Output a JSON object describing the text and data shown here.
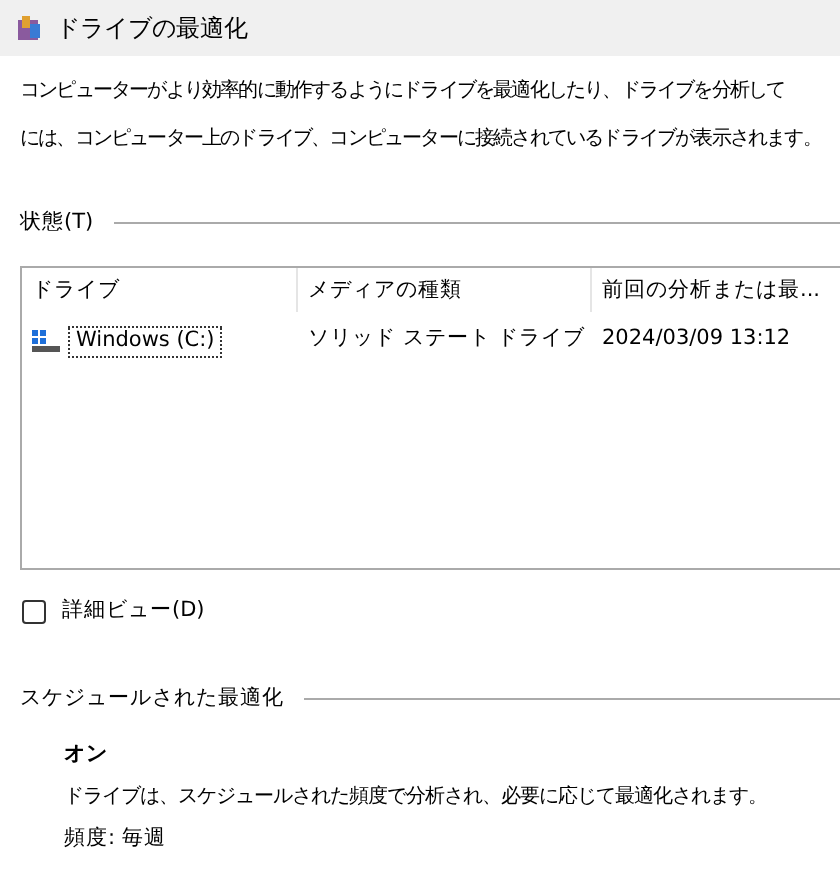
{
  "window": {
    "title": "ドライブの最適化"
  },
  "description": [
    "コンピューターがより効率的に動作するようにドライブを最適化したり、ドライブを分析して",
    "には、コンピューター上のドライブ、コンピューターに接続されているドライブが表示されます。"
  ],
  "status": {
    "label": "状態(T)",
    "columns": [
      "ドライブ",
      "メディアの種類",
      "前回の分析または最..."
    ],
    "rows": [
      {
        "drive": "Windows (C:)",
        "media_type": "ソリッド ステート ドライブ",
        "last_run": "2024/03/09 13:12",
        "selected": true
      }
    ]
  },
  "detail_view": {
    "label": "詳細ビュー(D)",
    "checked": false
  },
  "schedule": {
    "heading": "スケジュールされた最適化",
    "state": "オン",
    "description": "ドライブは、スケジュールされた頻度で分析され、必要に応じて最適化されます。",
    "frequency": "頻度: 毎週"
  }
}
